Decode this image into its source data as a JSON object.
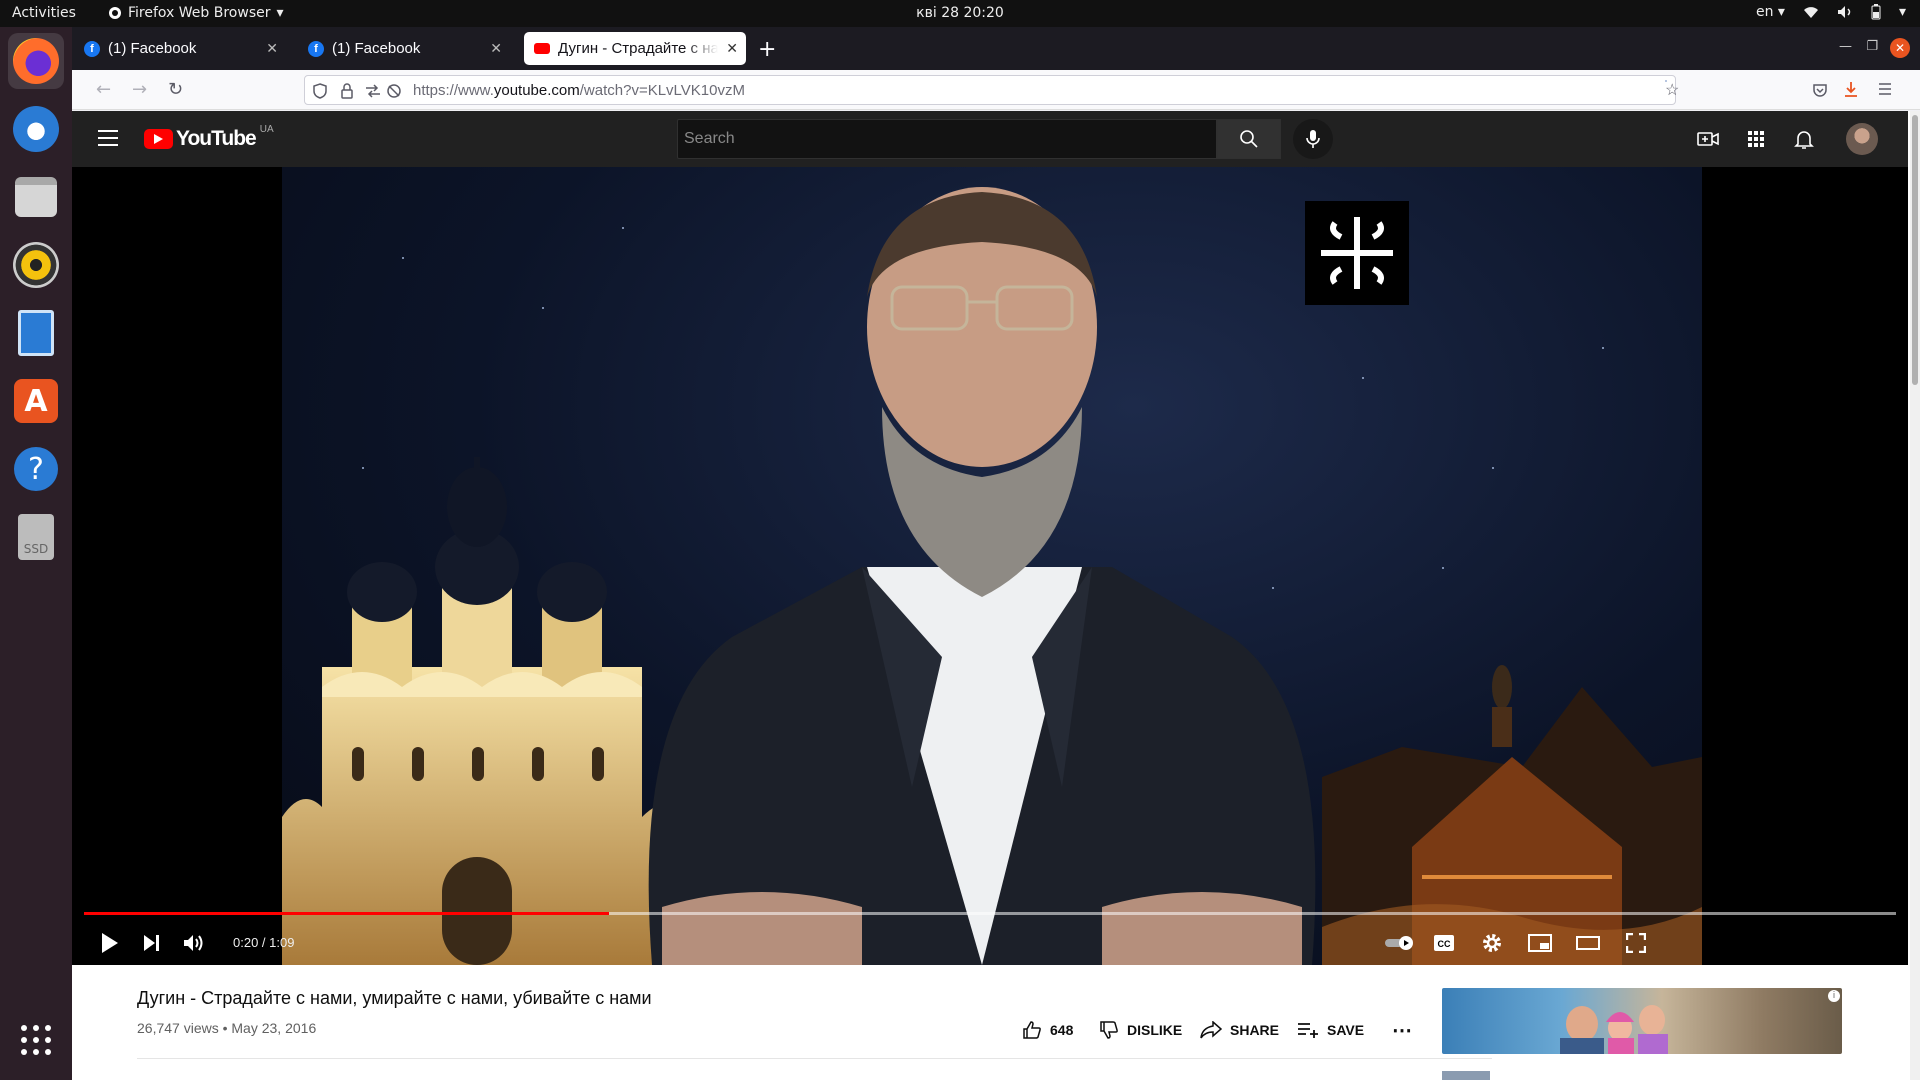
{
  "topbar": {
    "activities": "Activities",
    "app_menu": "Firefox Web Browser",
    "clock": "кві 28  20:20",
    "language": "en"
  },
  "dock": {
    "items": [
      "firefox",
      "thunderbird",
      "files",
      "rhythmbox",
      "libreoffice-writer",
      "ubuntu-software",
      "help",
      "ssd-drive",
      "show-applications"
    ],
    "ssd_label": "SSD"
  },
  "browser": {
    "tabs": [
      {
        "title": "(1) Facebook",
        "favicon": "facebook-icon"
      },
      {
        "title": "(1) Facebook",
        "favicon": "facebook-icon"
      },
      {
        "title": "Дугин - Страдайте с нами",
        "favicon": "youtube-icon",
        "active": true
      }
    ],
    "url_prefix": "https://www.",
    "url_domain": "youtube.com",
    "url_path": "/watch?v=KLvLVK10vzM"
  },
  "youtube": {
    "logo_text": "YouTube",
    "region": "UA",
    "search_placeholder": "Search",
    "player": {
      "current_time": "0:20",
      "duration": "1:09",
      "time_display": "0:20 / 1:09",
      "progress_fraction": 0.29,
      "buffered_fraction": 1.0
    },
    "video": {
      "title": "Дугин - Страдайте с нами, умирайте с нами, убивайте с нами",
      "views": "26,747 views",
      "date": "May 23, 2016",
      "meta": "26,747 views • May 23, 2016",
      "likes": "648",
      "dislike_label": "DISLIKE",
      "share_label": "SHARE",
      "save_label": "SAVE"
    },
    "ad_info": "i"
  },
  "colors": {
    "yt_red": "#ff0000",
    "ubuntu_orange": "#e95420",
    "header_bg": "#212121"
  }
}
